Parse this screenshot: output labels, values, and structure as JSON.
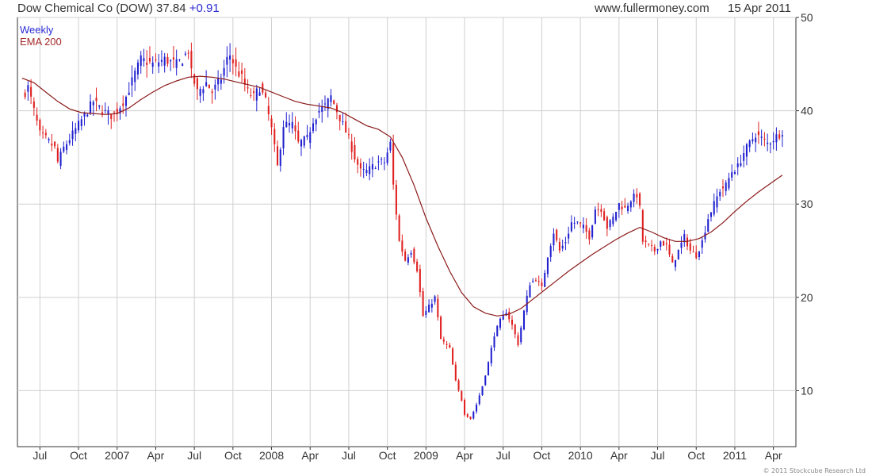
{
  "header": {
    "title": "Dow Chemical Co (DOW) 37.84",
    "change": "+0.91",
    "site": "www.fullermoney.com",
    "date": "15 Apr 2011"
  },
  "legend": {
    "weekly": "Weekly",
    "ema": "EMA 200"
  },
  "footer": "© 2011 Stockcube Research Ltd",
  "colors": {
    "up": "#2020d0",
    "down": "#e02020",
    "ema": "#8b1a1a",
    "grid": "#cfcfcf",
    "axis": "#333333"
  },
  "chart_data": {
    "type": "candlestick",
    "period": "Weekly",
    "ylim": [
      4,
      50
    ],
    "y_ticks": [
      10,
      20,
      30,
      40,
      50
    ],
    "grid": "on",
    "legend_position": "top-left",
    "x_ticks": [
      {
        "label": "Jul",
        "week": 6
      },
      {
        "label": "Oct",
        "week": 19
      },
      {
        "label": "2007",
        "week": 32
      },
      {
        "label": "Apr",
        "week": 45
      },
      {
        "label": "Jul",
        "week": 58
      },
      {
        "label": "Oct",
        "week": 71
      },
      {
        "label": "2008",
        "week": 84
      },
      {
        "label": "Apr",
        "week": 97
      },
      {
        "label": "Jul",
        "week": 110
      },
      {
        "label": "Oct",
        "week": 123
      },
      {
        "label": "2009",
        "week": 136
      },
      {
        "label": "Apr",
        "week": 149
      },
      {
        "label": "Jul",
        "week": 162
      },
      {
        "label": "Oct",
        "week": 175
      },
      {
        "label": "2010",
        "week": 188
      },
      {
        "label": "Apr",
        "week": 201
      },
      {
        "label": "Jul",
        "week": 214
      },
      {
        "label": "Oct",
        "week": 227
      },
      {
        "label": "2011",
        "week": 240
      },
      {
        "label": "Apr",
        "week": 253
      }
    ],
    "price_anchors": [
      [
        0,
        41.5
      ],
      [
        2,
        42.5
      ],
      [
        4,
        40.0
      ],
      [
        6,
        37.5
      ],
      [
        8,
        37.0
      ],
      [
        11,
        36.0
      ],
      [
        12,
        34.5
      ],
      [
        14,
        36.0
      ],
      [
        16,
        37.0
      ],
      [
        19,
        38.5
      ],
      [
        22,
        40.0
      ],
      [
        24,
        41.0
      ],
      [
        27,
        40.0
      ],
      [
        30,
        39.5
      ],
      [
        32,
        40.0
      ],
      [
        35,
        41.5
      ],
      [
        38,
        44.0
      ],
      [
        40,
        45.5
      ],
      [
        44,
        45.0
      ],
      [
        48,
        45.5
      ],
      [
        52,
        45.0
      ],
      [
        54,
        45.5
      ],
      [
        56,
        46.5
      ],
      [
        57,
        44.0
      ],
      [
        59,
        42.0
      ],
      [
        62,
        43.0
      ],
      [
        64,
        42.0
      ],
      [
        67,
        43.5
      ],
      [
        69,
        45.5
      ],
      [
        70,
        46.0
      ],
      [
        72,
        44.5
      ],
      [
        74,
        43.5
      ],
      [
        76,
        42.0
      ],
      [
        78,
        41.5
      ],
      [
        80,
        42.5
      ],
      [
        82,
        41.0
      ],
      [
        84,
        38.0
      ],
      [
        86,
        34.0
      ],
      [
        88,
        38.5
      ],
      [
        91,
        38.5
      ],
      [
        93,
        36.5
      ],
      [
        96,
        37.0
      ],
      [
        98,
        39.0
      ],
      [
        100,
        40.0
      ],
      [
        102,
        40.5
      ],
      [
        104,
        41.5
      ],
      [
        106,
        40.0
      ],
      [
        108,
        38.5
      ],
      [
        110,
        37.0
      ],
      [
        112,
        35.0
      ],
      [
        114,
        33.5
      ],
      [
        116,
        33.5
      ],
      [
        118,
        34.0
      ],
      [
        120,
        34.5
      ],
      [
        122,
        34.5
      ],
      [
        124,
        36.5
      ],
      [
        125,
        32.0
      ],
      [
        127,
        26.0
      ],
      [
        129,
        24.0
      ],
      [
        131,
        25.0
      ],
      [
        133,
        23.0
      ],
      [
        135,
        18.0
      ],
      [
        137,
        19.0
      ],
      [
        139,
        20.0
      ],
      [
        141,
        15.5
      ],
      [
        144,
        14.5
      ],
      [
        146,
        11.0
      ],
      [
        148,
        9.0
      ],
      [
        149,
        7.5
      ],
      [
        151,
        7.0
      ],
      [
        153,
        8.5
      ],
      [
        155,
        10.5
      ],
      [
        157,
        13.0
      ],
      [
        159,
        16.0
      ],
      [
        161,
        17.5
      ],
      [
        163,
        18.5
      ],
      [
        165,
        17.0
      ],
      [
        167,
        15.0
      ],
      [
        169,
        18.5
      ],
      [
        171,
        21.5
      ],
      [
        173,
        22.0
      ],
      [
        175,
        21.0
      ],
      [
        177,
        24.5
      ],
      [
        179,
        27.0
      ],
      [
        181,
        25.0
      ],
      [
        183,
        26.0
      ],
      [
        185,
        28.0
      ],
      [
        187,
        28.0
      ],
      [
        189,
        27.5
      ],
      [
        191,
        26.5
      ],
      [
        193,
        29.5
      ],
      [
        195,
        29.5
      ],
      [
        197,
        27.5
      ],
      [
        199,
        28.5
      ],
      [
        201,
        30.0
      ],
      [
        203,
        29.5
      ],
      [
        205,
        30.5
      ],
      [
        207,
        31.0
      ],
      [
        208,
        29.5
      ],
      [
        209,
        26.0
      ],
      [
        211,
        25.5
      ],
      [
        213,
        25.0
      ],
      [
        215,
        26.0
      ],
      [
        217,
        25.5
      ],
      [
        219,
        23.5
      ],
      [
        221,
        25.0
      ],
      [
        223,
        26.5
      ],
      [
        225,
        25.0
      ],
      [
        227,
        24.5
      ],
      [
        229,
        26.0
      ],
      [
        231,
        28.5
      ],
      [
        233,
        30.0
      ],
      [
        235,
        31.5
      ],
      [
        237,
        32.0
      ],
      [
        239,
        33.5
      ],
      [
        241,
        34.0
      ],
      [
        243,
        35.5
      ],
      [
        245,
        36.5
      ],
      [
        247,
        37.5
      ],
      [
        249,
        37.0
      ],
      [
        251,
        36.5
      ],
      [
        253,
        37.0
      ],
      [
        255,
        37.5
      ],
      [
        256,
        37.84
      ]
    ],
    "ema_anchors": [
      [
        0,
        43.5
      ],
      [
        4,
        43.0
      ],
      [
        8,
        42.0
      ],
      [
        12,
        41.0
      ],
      [
        16,
        40.2
      ],
      [
        20,
        39.8
      ],
      [
        24,
        39.7
      ],
      [
        28,
        39.6
      ],
      [
        32,
        39.7
      ],
      [
        36,
        40.3
      ],
      [
        40,
        41.2
      ],
      [
        44,
        42.0
      ],
      [
        48,
        42.7
      ],
      [
        52,
        43.2
      ],
      [
        56,
        43.6
      ],
      [
        60,
        43.7
      ],
      [
        64,
        43.6
      ],
      [
        68,
        43.4
      ],
      [
        72,
        43.1
      ],
      [
        76,
        42.8
      ],
      [
        80,
        42.5
      ],
      [
        84,
        42.0
      ],
      [
        88,
        41.5
      ],
      [
        92,
        41.0
      ],
      [
        96,
        40.7
      ],
      [
        100,
        40.5
      ],
      [
        104,
        40.3
      ],
      [
        108,
        39.8
      ],
      [
        112,
        39.1
      ],
      [
        116,
        38.4
      ],
      [
        120,
        38.0
      ],
      [
        124,
        37.2
      ],
      [
        128,
        35.0
      ],
      [
        132,
        32.0
      ],
      [
        136,
        28.5
      ],
      [
        140,
        25.5
      ],
      [
        144,
        22.8
      ],
      [
        148,
        20.5
      ],
      [
        152,
        19.0
      ],
      [
        156,
        18.3
      ],
      [
        160,
        18.0
      ],
      [
        164,
        18.2
      ],
      [
        168,
        18.8
      ],
      [
        172,
        19.8
      ],
      [
        176,
        20.8
      ],
      [
        180,
        21.8
      ],
      [
        184,
        22.8
      ],
      [
        188,
        23.7
      ],
      [
        192,
        24.6
      ],
      [
        196,
        25.4
      ],
      [
        200,
        26.2
      ],
      [
        204,
        26.9
      ],
      [
        208,
        27.5
      ],
      [
        212,
        27.0
      ],
      [
        216,
        26.4
      ],
      [
        220,
        26.0
      ],
      [
        224,
        26.0
      ],
      [
        228,
        26.3
      ],
      [
        232,
        27.0
      ],
      [
        236,
        28.0
      ],
      [
        240,
        29.2
      ],
      [
        244,
        30.3
      ],
      [
        248,
        31.3
      ],
      [
        252,
        32.2
      ],
      [
        256,
        33.1
      ]
    ]
  }
}
